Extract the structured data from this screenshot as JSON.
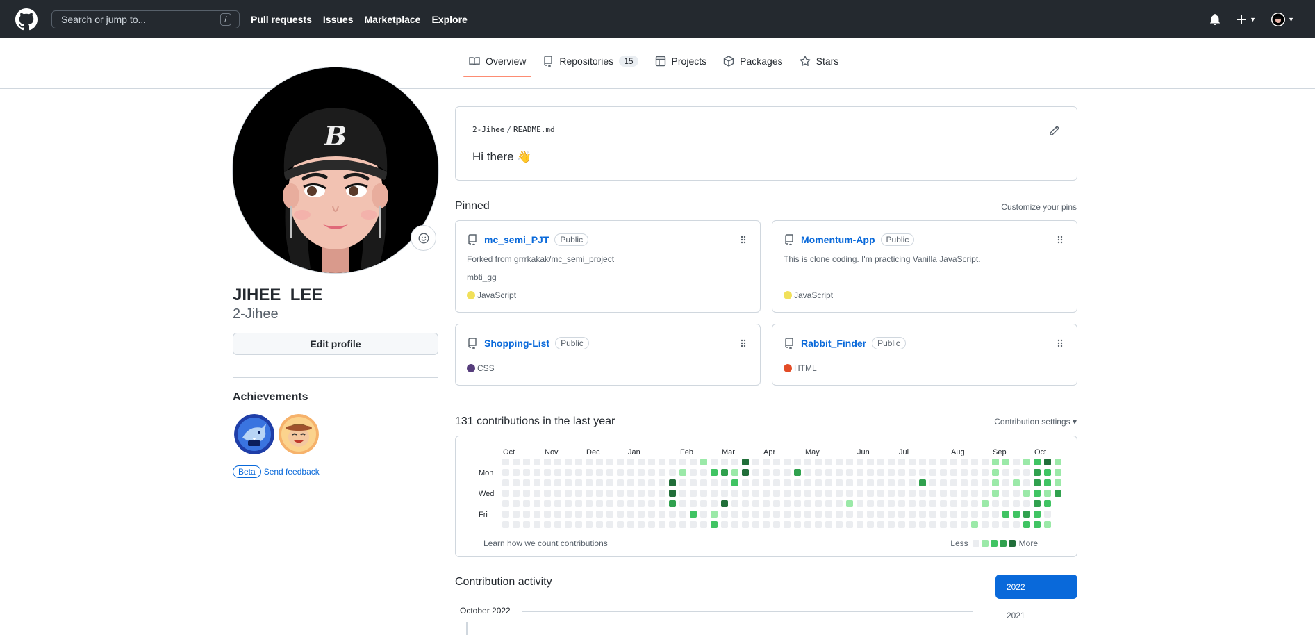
{
  "header": {
    "search_placeholder": "Search or jump to...",
    "search_shortcut": "/",
    "nav": [
      "Pull requests",
      "Issues",
      "Marketplace",
      "Explore"
    ]
  },
  "tabs": [
    {
      "label": "Overview",
      "icon": "book-icon",
      "active": true
    },
    {
      "label": "Repositories",
      "icon": "repo-icon",
      "count": "15"
    },
    {
      "label": "Projects",
      "icon": "table-icon"
    },
    {
      "label": "Packages",
      "icon": "package-icon"
    },
    {
      "label": "Stars",
      "icon": "star-icon"
    }
  ],
  "profile": {
    "full_name": "JIHEE_LEE",
    "username": "2-Jihee",
    "edit_label": "Edit profile",
    "achievements_title": "Achievements",
    "beta_label": "Beta",
    "feedback_label": "Send feedback"
  },
  "readme": {
    "owner": "2-Jihee",
    "separator": "/",
    "file": "README.md",
    "heading": "Hi there 👋"
  },
  "pinned": {
    "title": "Pinned",
    "customize_label": "Customize your pins",
    "cards": [
      {
        "name": "mc_semi_PJT",
        "visibility": "Public",
        "forked_from": "Forked from grrrkakak/mc_semi_project",
        "desc": "mbti_gg",
        "lang": "JavaScript",
        "lang_color": "#f1e05a"
      },
      {
        "name": "Momentum-App",
        "visibility": "Public",
        "desc": "This is clone coding. I'm practicing Vanilla JavaScript.",
        "lang": "JavaScript",
        "lang_color": "#f1e05a"
      },
      {
        "name": "Shopping-List",
        "visibility": "Public",
        "lang": "CSS",
        "lang_color": "#563d7c"
      },
      {
        "name": "Rabbit_Finder",
        "visibility": "Public",
        "lang": "HTML",
        "lang_color": "#e34c26"
      }
    ]
  },
  "contributions": {
    "title": "131 contributions in the last year",
    "settings_label": "Contribution settings ▾",
    "months": [
      "Oct",
      "Nov",
      "Dec",
      "Jan",
      "Feb",
      "Mar",
      "Apr",
      "May",
      "Jun",
      "Jul",
      "Aug",
      "Sep",
      "Oct"
    ],
    "days": [
      "Mon",
      "Wed",
      "Fri"
    ],
    "learn_label": "Learn how we count contributions",
    "legend_less": "Less",
    "legend_more": "More",
    "level_colors": [
      "#ebedf0",
      "#9be9a8",
      "#40c463",
      "#30a14e",
      "#216e39"
    ]
  },
  "activity": {
    "title": "Contribution activity",
    "month_label": "October 2022",
    "years": [
      "2022",
      "2021"
    ]
  },
  "colors": {
    "header_bg": "#24292f",
    "link": "#0969da",
    "tab_underline": "#fd8c73"
  }
}
